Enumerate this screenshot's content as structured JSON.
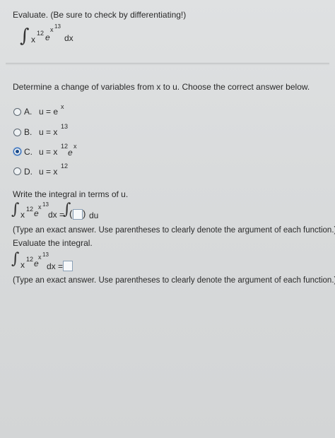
{
  "prompt": {
    "instruction": "Evaluate. (Be sure to check by differentiating!)",
    "integrand": {
      "base1": "x",
      "exp1": "12",
      "base2": "e",
      "exp2_base": "x",
      "exp2_exp": "13",
      "dx": "dx"
    }
  },
  "part1": {
    "question": "Determine a change of variables from x to u. Choose the correct answer below.",
    "options": [
      {
        "letter": "A.",
        "text": "u = e",
        "sup": "x",
        "selected": false
      },
      {
        "letter": "B.",
        "text": "u = x",
        "sup": "13",
        "selected": false
      },
      {
        "letter": "C.",
        "text": "u = x",
        "sup": "12",
        "text2": "e",
        "sup2": "x",
        "selected": true
      },
      {
        "letter": "D.",
        "text": "u = x",
        "sup": "12",
        "selected": false
      }
    ]
  },
  "part2": {
    "question": "Write the integral in terms of u.",
    "equals": "dx =",
    "du": "du",
    "hint": "(Type an exact answer. Use parentheses to clearly denote the argument of each function.)"
  },
  "part3": {
    "question": "Evaluate the integral.",
    "equals": "dx =",
    "hint": "(Type an exact answer. Use parentheses to clearly denote the argument of each function.)"
  }
}
